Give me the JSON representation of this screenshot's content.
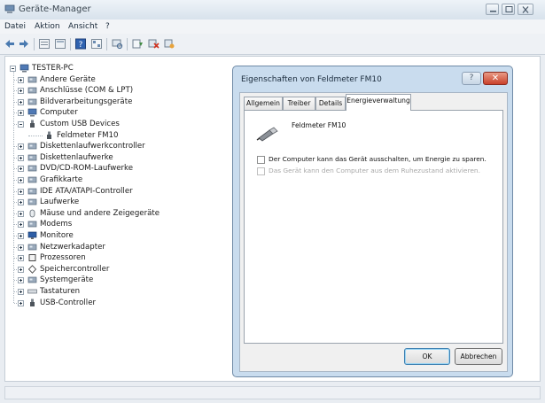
{
  "window": {
    "title": "Geräte-Manager",
    "icon": "device-manager-icon"
  },
  "menu": [
    "Datei",
    "Aktion",
    "Ansicht",
    "?"
  ],
  "toolbar": {
    "buttons": [
      "back-arrow-icon",
      "forward-arrow-icon",
      "view-icon",
      "properties-icon",
      "help-icon",
      "refresh-icon",
      "scan-hardware-icon",
      "update-driver-icon",
      "uninstall-icon",
      "disable-icon"
    ]
  },
  "tree": {
    "root": "TESTER-PC",
    "items": [
      {
        "label": "Andere Geräte",
        "icon": "other-devices-icon"
      },
      {
        "label": "Anschlüsse (COM & LPT)",
        "icon": "port-icon"
      },
      {
        "label": "Bildverarbeitungsgeräte",
        "icon": "imaging-device-icon"
      },
      {
        "label": "Computer",
        "icon": "computer-icon"
      },
      {
        "label": "Custom USB Devices",
        "icon": "usb-plug-icon",
        "expanded": true
      },
      {
        "label": "Feldmeter FM10",
        "icon": "usb-plug-icon",
        "child": true
      },
      {
        "label": "Diskettenlaufwerkcontroller",
        "icon": "floppy-controller-icon"
      },
      {
        "label": "Diskettenlaufwerke",
        "icon": "floppy-drive-icon"
      },
      {
        "label": "DVD/CD-ROM-Laufwerke",
        "icon": "dvd-drive-icon"
      },
      {
        "label": "Grafikkarte",
        "icon": "display-adapter-icon"
      },
      {
        "label": "IDE ATA/ATAPI-Controller",
        "icon": "ide-controller-icon"
      },
      {
        "label": "Laufwerke",
        "icon": "disk-drive-icon"
      },
      {
        "label": "Mäuse und andere Zeigegeräte",
        "icon": "mouse-icon"
      },
      {
        "label": "Modems",
        "icon": "modem-icon"
      },
      {
        "label": "Monitore",
        "icon": "monitor-icon"
      },
      {
        "label": "Netzwerkadapter",
        "icon": "network-adapter-icon"
      },
      {
        "label": "Prozessoren",
        "icon": "processor-icon"
      },
      {
        "label": "Speichercontroller",
        "icon": "storage-controller-icon"
      },
      {
        "label": "Systemgeräte",
        "icon": "system-devices-icon"
      },
      {
        "label": "Tastaturen",
        "icon": "keyboard-icon"
      },
      {
        "label": "USB-Controller",
        "icon": "usb-plug-icon"
      }
    ]
  },
  "dialog": {
    "title": "Eigenschaften von Feldmeter FM10",
    "help_label": "?",
    "close_label": "✕",
    "tabs": [
      "Allgemein",
      "Treiber",
      "Details",
      "Energieverwaltung"
    ],
    "active_tab": "Energieverwaltung",
    "device_name": "Feldmeter FM10",
    "checkbox_allow_off": "Der Computer kann das Gerät ausschalten, um Energie zu sparen.",
    "checkbox_wake": "Das Gerät kann den Computer aus dem Ruhezustand aktivieren.",
    "ok_label": "OK",
    "cancel_label": "Abbrechen"
  },
  "colors": {
    "dialog_frame": "#c9dcee",
    "close_button": "#c9412a"
  }
}
